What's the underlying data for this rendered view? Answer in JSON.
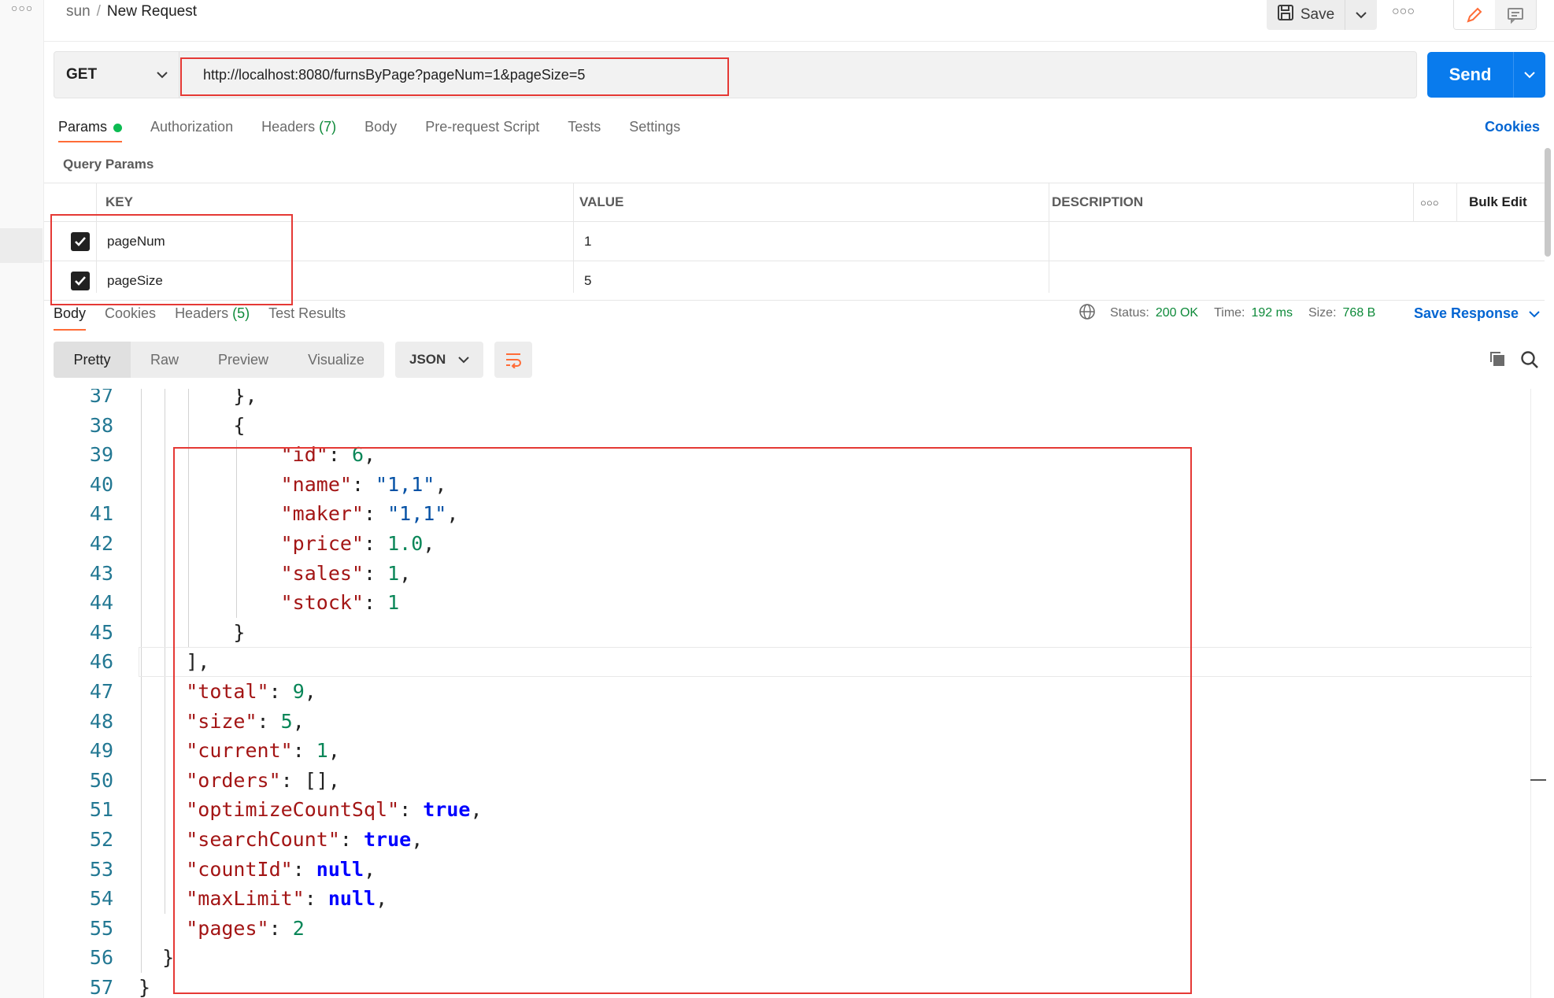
{
  "header": {
    "workspace": "sun",
    "separator": "/",
    "request_name": "New Request",
    "save_label": "Save"
  },
  "request": {
    "method": "GET",
    "url": "http://localhost:8080/furnsByPage?pageNum=1&pageSize=5",
    "send_label": "Send"
  },
  "request_tabs": [
    {
      "label": "Params",
      "count": ""
    },
    {
      "label": "Authorization",
      "count": ""
    },
    {
      "label": "Headers",
      "count": "(7)"
    },
    {
      "label": "Body",
      "count": ""
    },
    {
      "label": "Pre-request Script",
      "count": ""
    },
    {
      "label": "Tests",
      "count": ""
    },
    {
      "label": "Settings",
      "count": ""
    }
  ],
  "cookies_label": "Cookies",
  "query_params": {
    "title": "Query Params",
    "headers": {
      "key": "KEY",
      "value": "VALUE",
      "description": "DESCRIPTION",
      "bulk_edit": "Bulk Edit"
    },
    "rows": [
      {
        "key": "pageNum",
        "value": "1",
        "description": "",
        "checked": true
      },
      {
        "key": "pageSize",
        "value": "5",
        "description": "",
        "checked": true
      }
    ]
  },
  "response": {
    "tabs": [
      {
        "label": "Body",
        "count": ""
      },
      {
        "label": "Cookies",
        "count": ""
      },
      {
        "label": "Headers",
        "count": "(5)"
      },
      {
        "label": "Test Results",
        "count": ""
      }
    ],
    "status_label": "Status:",
    "status_value": "200 OK",
    "time_label": "Time:",
    "time_value": "192 ms",
    "size_label": "Size:",
    "size_value": "768 B",
    "save_response_label": "Save Response",
    "view_modes": [
      "Pretty",
      "Raw",
      "Preview",
      "Visualize"
    ],
    "format": "JSON"
  },
  "code_lines": [
    {
      "n": "37",
      "html": "&#125;,",
      "indent": 8
    },
    {
      "n": "38",
      "html": "&#123;",
      "indent": 8
    },
    {
      "n": "39",
      "html": "<span class=\"k\">\"id\"</span>: <span class=\"n\">6</span>,",
      "indent": 12
    },
    {
      "n": "40",
      "html": "<span class=\"k\">\"name\"</span>: <span class=\"s\">\"1,1\"</span>,",
      "indent": 12
    },
    {
      "n": "41",
      "html": "<span class=\"k\">\"maker\"</span>: <span class=\"s\">\"1,1\"</span>,",
      "indent": 12
    },
    {
      "n": "42",
      "html": "<span class=\"k\">\"price\"</span>: <span class=\"n\">1.0</span>,",
      "indent": 12
    },
    {
      "n": "43",
      "html": "<span class=\"k\">\"sales\"</span>: <span class=\"n\">1</span>,",
      "indent": 12
    },
    {
      "n": "44",
      "html": "<span class=\"k\">\"stock\"</span>: <span class=\"n\">1</span>",
      "indent": 12
    },
    {
      "n": "45",
      "html": "&#125;",
      "indent": 8
    },
    {
      "n": "46",
      "html": "],",
      "indent": 4
    },
    {
      "n": "47",
      "html": "<span class=\"k\">\"total\"</span>: <span class=\"n\">9</span>,",
      "indent": 4
    },
    {
      "n": "48",
      "html": "<span class=\"k\">\"size\"</span>: <span class=\"n\">5</span>,",
      "indent": 4
    },
    {
      "n": "49",
      "html": "<span class=\"k\">\"current\"</span>: <span class=\"n\">1</span>,",
      "indent": 4
    },
    {
      "n": "50",
      "html": "<span class=\"k\">\"orders\"</span>: [],",
      "indent": 4
    },
    {
      "n": "51",
      "html": "<span class=\"k\">\"optimizeCountSql\"</span>: <span class=\"b\">true</span>,",
      "indent": 4
    },
    {
      "n": "52",
      "html": "<span class=\"k\">\"searchCount\"</span>: <span class=\"b\">true</span>,",
      "indent": 4
    },
    {
      "n": "53",
      "html": "<span class=\"k\">\"countId\"</span>: <span class=\"b\">null</span>,",
      "indent": 4
    },
    {
      "n": "54",
      "html": "<span class=\"k\">\"maxLimit\"</span>: <span class=\"b\">null</span>,",
      "indent": 4
    },
    {
      "n": "55",
      "html": "<span class=\"k\">\"pages\"</span>: <span class=\"n\">2</span>",
      "indent": 4
    },
    {
      "n": "56",
      "html": "&#125;",
      "indent": 2
    },
    {
      "n": "57",
      "html": "&#125;",
      "indent": 0
    }
  ],
  "icons": {
    "more": "more-horizontal-icon",
    "save": "floppy-disk-icon",
    "edit": "pencil-icon",
    "comment": "comment-icon",
    "globe": "globe-icon",
    "copy": "copy-icon",
    "search": "search-icon",
    "wrap": "wrap-lines-icon"
  },
  "colors": {
    "accent_orange": "#ff6c37",
    "send_blue": "#097bed",
    "link_blue": "#0265d2",
    "status_green": "#0e8a3a",
    "annotation_red": "#e53935"
  }
}
